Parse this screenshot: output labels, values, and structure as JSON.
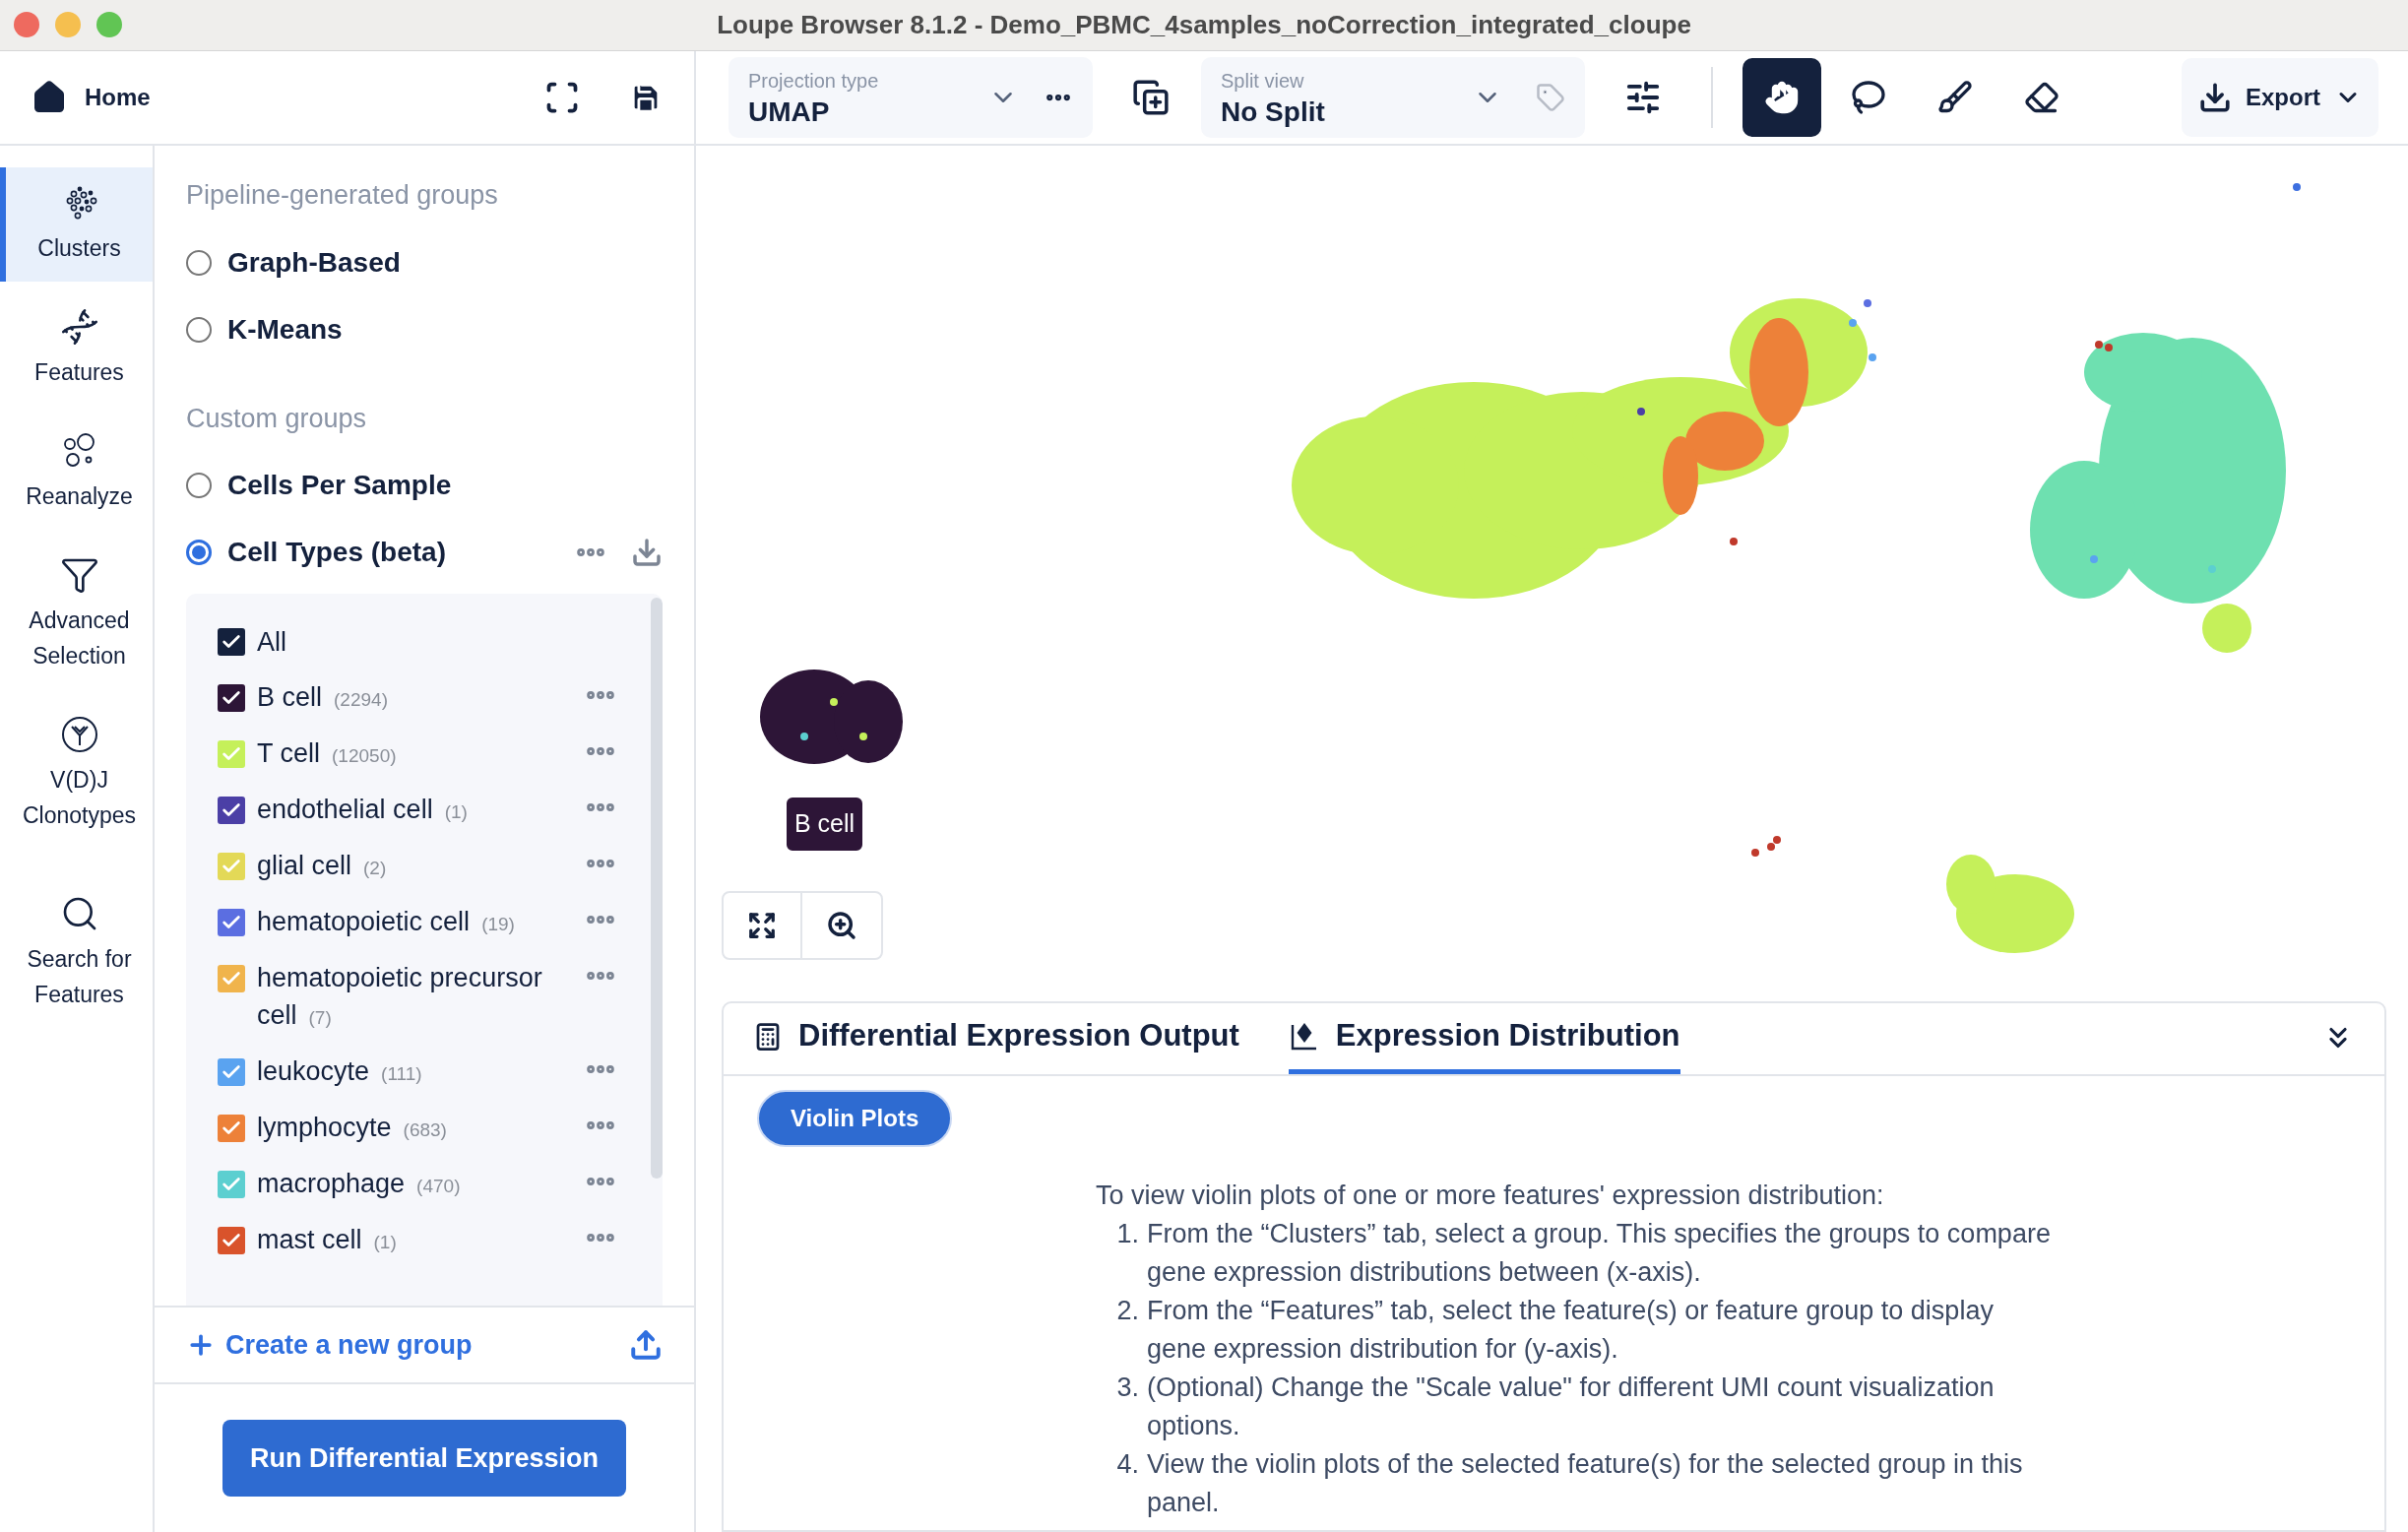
{
  "window": {
    "title": "Loupe Browser 8.1.2 - Demo_PBMC_4samples_noCorrection_integrated_cloupe"
  },
  "home": {
    "label": "Home"
  },
  "projection": {
    "label": "Projection type",
    "value": "UMAP"
  },
  "split": {
    "label": "Split view",
    "value": "No Split"
  },
  "tools": [
    {
      "kind": "pan",
      "selected": true
    },
    {
      "kind": "lasso",
      "selected": false
    },
    {
      "kind": "brush",
      "selected": false
    },
    {
      "kind": "eraser",
      "selected": false
    }
  ],
  "export": {
    "label": "Export"
  },
  "nav": [
    {
      "kind": "clusters",
      "label": "Clusters",
      "selected": true
    },
    {
      "kind": "features",
      "label": "Features",
      "selected": false
    },
    {
      "kind": "reanalyze",
      "label": "Reanalyze",
      "selected": false
    },
    {
      "kind": "filter",
      "label": "Advanced Selection",
      "selected": false
    },
    {
      "kind": "vdj",
      "label": "V(D)J Clonotypes",
      "selected": false
    },
    {
      "kind": "search",
      "label": "Search for Features",
      "selected": false
    }
  ],
  "group_sections": [
    {
      "heading": "Pipeline-generated groups",
      "options": [
        {
          "label": "Graph-Based",
          "selected": false
        },
        {
          "label": "K-Means",
          "selected": false
        }
      ]
    },
    {
      "heading": "Custom groups",
      "options": [
        {
          "label": "Cells Per Sample",
          "selected": false
        },
        {
          "label": "Cell Types (beta)",
          "selected": true
        }
      ]
    }
  ],
  "all": {
    "label": "All",
    "checked": true
  },
  "cell_types": [
    {
      "label": "B cell",
      "count": "(2294)",
      "checked": true,
      "color": "#2d1537"
    },
    {
      "label": "T cell",
      "count": "(12050)",
      "checked": true,
      "color": "#c5f05a"
    },
    {
      "label": "endothelial cell",
      "count": "(1)",
      "checked": true,
      "color": "#4b3fa6"
    },
    {
      "label": "glial cell",
      "count": "(2)",
      "checked": true,
      "color": "#e3d957"
    },
    {
      "label": "hematopoietic cell",
      "count": "(19)",
      "checked": true,
      "color": "#5b6ee1"
    },
    {
      "label": "hematopoietic precursor cell",
      "count": "(7)",
      "checked": true,
      "color": "#f0b44c"
    },
    {
      "label": "leukocyte",
      "count": "(111)",
      "checked": true,
      "color": "#5aa3f0"
    },
    {
      "label": "lymphocyte",
      "count": "(683)",
      "checked": true,
      "color": "#ed8139"
    },
    {
      "label": "macrophage",
      "count": "(470)",
      "checked": true,
      "color": "#5ccfd0"
    },
    {
      "label": "mast cell",
      "count": "(1)",
      "checked": true,
      "color": "#d9532b"
    }
  ],
  "create_group": {
    "label": "Create a new group"
  },
  "run_button": {
    "label": "Run Differential Expression"
  },
  "plot": {
    "cluster_label": "B cell"
  },
  "bottom": {
    "tabs": [
      {
        "kind": "table",
        "label": "Differential Expression Output",
        "selected": false
      },
      {
        "kind": "distribution",
        "label": "Expression Distribution",
        "selected": true
      }
    ],
    "subtab": {
      "label": "Violin Plots",
      "selected": true
    },
    "intro": "To view violin plots of one or more features' expression distribution:",
    "steps": [
      {
        "number": "1.",
        "text": "From the “Clusters” tab, select a group. This specifies the groups to compare gene expression distributions between (x-axis)."
      },
      {
        "number": "2.",
        "text": "From the “Features” tab, select the feature(s) or feature group to display gene expression distribution for (y-axis)."
      },
      {
        "number": "3.",
        "text": "(Optional) Change the \"Scale value\" for different UMI count visualization options."
      },
      {
        "number": "4.",
        "text": "View the violin plots of the selected feature(s) for the selected group in this panel."
      }
    ]
  }
}
